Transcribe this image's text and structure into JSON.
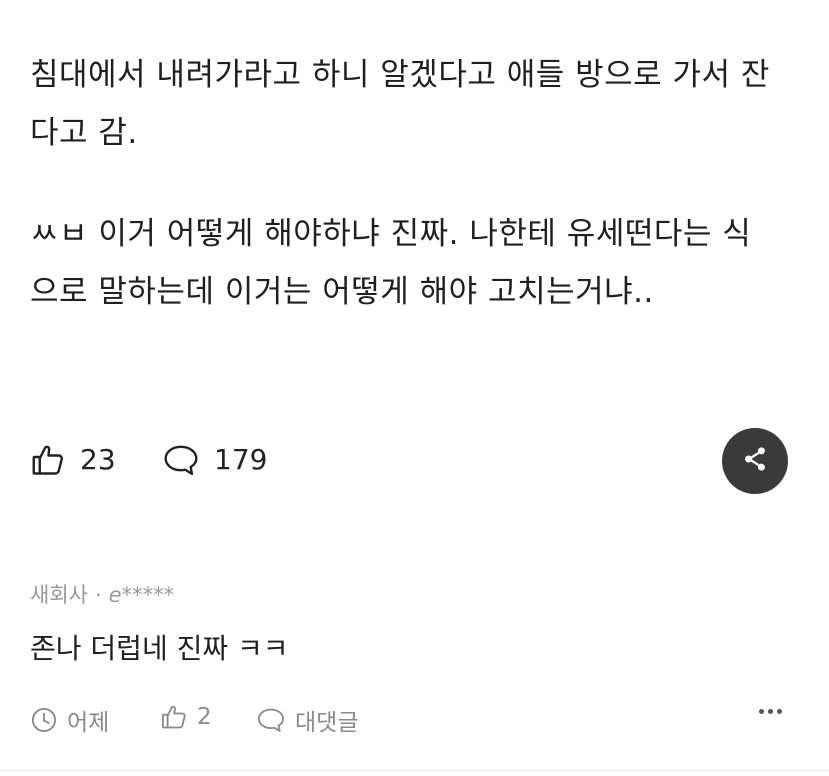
{
  "post": {
    "paragraphs": [
      "침대에서 내려가라고 하니 알겠다고 애들 방으로 가서 잔\n다고 감.",
      "ㅆㅂ 이거 어떻게 해야하냐 진짜. 나한테 유세떤다는 식\n으로 말하는데 이거는 어떻게 해야 고치는거냐.."
    ]
  },
  "actions": {
    "like_icon": "thumbs-up-icon",
    "like_count": "23",
    "comment_icon": "speech-bubble-icon",
    "comment_count": "179",
    "share_icon": "share-icon",
    "share_button_color": "#3a3a3a"
  },
  "comment": {
    "company": "새회사",
    "separator": "·",
    "author": "e*****",
    "text": "존나 더럽네 진짜 ㅋㅋ",
    "time_icon": "clock-icon",
    "time": "어제",
    "like_icon": "thumbs-up-icon",
    "like_count": "2",
    "reply_icon": "speech-bubble-icon",
    "reply_label": "대댓글",
    "more_icon": "more-dots-icon"
  },
  "colors": {
    "text": "#1f1f1f",
    "muted": "#999999",
    "action_gray": "#8a8a8a"
  }
}
